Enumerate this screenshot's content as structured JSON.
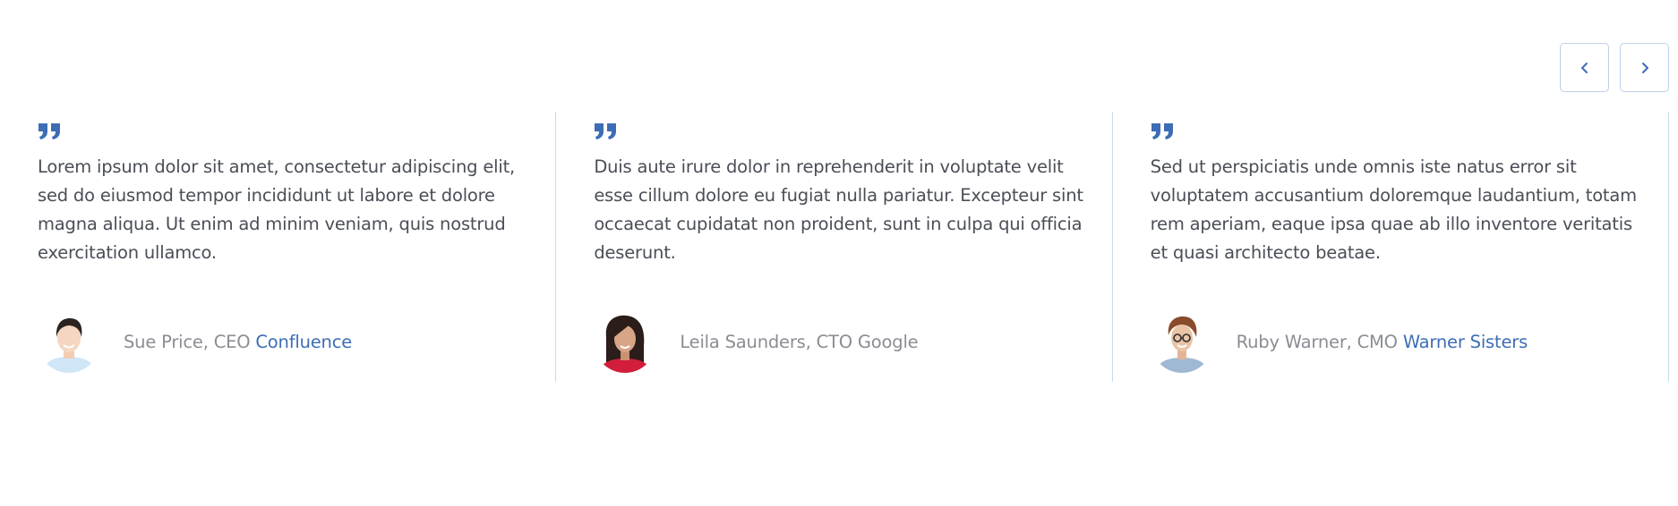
{
  "navigation": {
    "prev_icon": "chevron-left-icon",
    "next_icon": "chevron-right-icon"
  },
  "colors": {
    "accent": "#3d6db5",
    "text": "#4a4e57",
    "muted": "#8a8d93",
    "border": "#c9d9ec"
  },
  "testimonials": [
    {
      "quote_icon": "quote-icon",
      "text": "Lorem ipsum dolor sit amet, consectetur adipiscing elit, sed do eiusmod tempor incididunt ut labore et dolore magna aliqua. Ut enim ad minim veniam, quis nostrud exercitation ullamco.",
      "author": "Sue Price, CEO ",
      "company": "Confluence",
      "company_is_link": true
    },
    {
      "quote_icon": "quote-icon",
      "text": "Duis aute irure dolor in reprehenderit in voluptate velit esse cillum dolore eu fugiat nulla pariatur. Excepteur sint occaecat cupidatat non proident, sunt in culpa qui officia deserunt.",
      "author": "Leila Saunders, CTO Google",
      "company": "",
      "company_is_link": false
    },
    {
      "quote_icon": "quote-icon",
      "text": "Sed ut perspiciatis unde omnis iste natus error sit voluptatem accusantium doloremque laudantium, totam rem aperiam, eaque ipsa quae ab illo inventore veritatis et quasi architecto beatae.",
      "author": "Ruby Warner, CMO ",
      "company": "Warner Sisters",
      "company_is_link": true
    }
  ]
}
